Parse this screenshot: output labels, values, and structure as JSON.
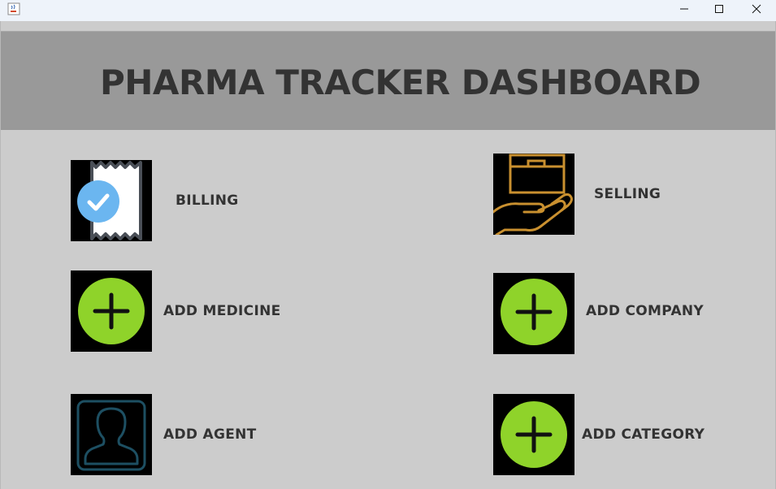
{
  "window": {
    "app_icon": "java-coffee-cup-icon",
    "controls": [
      "minimize-icon",
      "maximize-icon",
      "close-icon"
    ]
  },
  "header": {
    "title": "PHARMA TRACKER DASHBOARD"
  },
  "menu": {
    "billing": {
      "label": "BILLING",
      "icon": "receipt-check-icon"
    },
    "selling": {
      "label": "SELLING",
      "icon": "hand-package-icon"
    },
    "add_medicine": {
      "label": "ADD MEDICINE",
      "icon": "plus-circle-icon"
    },
    "add_company": {
      "label": "ADD COMPANY",
      "icon": "plus-circle-icon"
    },
    "add_agent": {
      "label": "ADD AGENT",
      "icon": "person-profile-icon"
    },
    "add_category": {
      "label": "ADD CATEGORY",
      "icon": "plus-circle-icon"
    }
  },
  "colors": {
    "header_bg": "#999999",
    "body_bg": "#cccccc",
    "text": "#333333",
    "plus_green": "#8fd32a",
    "check_blue": "#6bb6f0",
    "hand_gold": "#c9902f",
    "agent_teal": "#1d4f62"
  }
}
